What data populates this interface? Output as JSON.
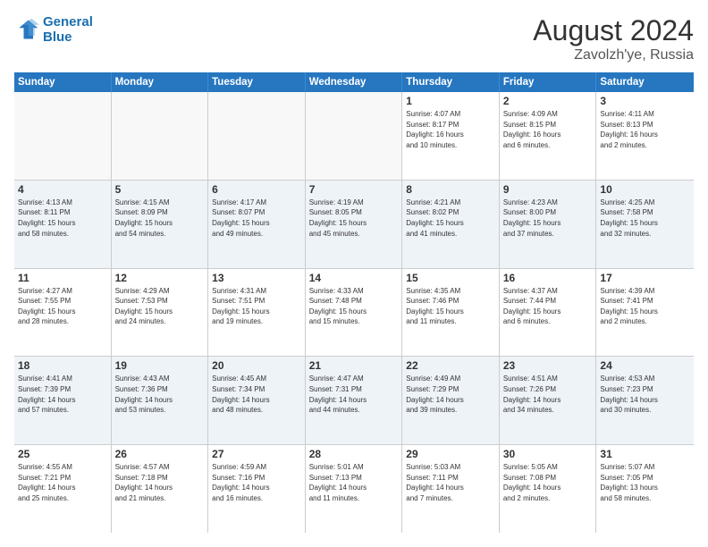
{
  "logo": {
    "line1": "General",
    "line2": "Blue"
  },
  "title": "August 2024",
  "subtitle": "Zavolzh'ye, Russia",
  "header_days": [
    "Sunday",
    "Monday",
    "Tuesday",
    "Wednesday",
    "Thursday",
    "Friday",
    "Saturday"
  ],
  "weeks": [
    [
      {
        "day": "",
        "info": ""
      },
      {
        "day": "",
        "info": ""
      },
      {
        "day": "",
        "info": ""
      },
      {
        "day": "",
        "info": ""
      },
      {
        "day": "1",
        "info": "Sunrise: 4:07 AM\nSunset: 8:17 PM\nDaylight: 16 hours\nand 10 minutes."
      },
      {
        "day": "2",
        "info": "Sunrise: 4:09 AM\nSunset: 8:15 PM\nDaylight: 16 hours\nand 6 minutes."
      },
      {
        "day": "3",
        "info": "Sunrise: 4:11 AM\nSunset: 8:13 PM\nDaylight: 16 hours\nand 2 minutes."
      }
    ],
    [
      {
        "day": "4",
        "info": "Sunrise: 4:13 AM\nSunset: 8:11 PM\nDaylight: 15 hours\nand 58 minutes."
      },
      {
        "day": "5",
        "info": "Sunrise: 4:15 AM\nSunset: 8:09 PM\nDaylight: 15 hours\nand 54 minutes."
      },
      {
        "day": "6",
        "info": "Sunrise: 4:17 AM\nSunset: 8:07 PM\nDaylight: 15 hours\nand 49 minutes."
      },
      {
        "day": "7",
        "info": "Sunrise: 4:19 AM\nSunset: 8:05 PM\nDaylight: 15 hours\nand 45 minutes."
      },
      {
        "day": "8",
        "info": "Sunrise: 4:21 AM\nSunset: 8:02 PM\nDaylight: 15 hours\nand 41 minutes."
      },
      {
        "day": "9",
        "info": "Sunrise: 4:23 AM\nSunset: 8:00 PM\nDaylight: 15 hours\nand 37 minutes."
      },
      {
        "day": "10",
        "info": "Sunrise: 4:25 AM\nSunset: 7:58 PM\nDaylight: 15 hours\nand 32 minutes."
      }
    ],
    [
      {
        "day": "11",
        "info": "Sunrise: 4:27 AM\nSunset: 7:55 PM\nDaylight: 15 hours\nand 28 minutes."
      },
      {
        "day": "12",
        "info": "Sunrise: 4:29 AM\nSunset: 7:53 PM\nDaylight: 15 hours\nand 24 minutes."
      },
      {
        "day": "13",
        "info": "Sunrise: 4:31 AM\nSunset: 7:51 PM\nDaylight: 15 hours\nand 19 minutes."
      },
      {
        "day": "14",
        "info": "Sunrise: 4:33 AM\nSunset: 7:48 PM\nDaylight: 15 hours\nand 15 minutes."
      },
      {
        "day": "15",
        "info": "Sunrise: 4:35 AM\nSunset: 7:46 PM\nDaylight: 15 hours\nand 11 minutes."
      },
      {
        "day": "16",
        "info": "Sunrise: 4:37 AM\nSunset: 7:44 PM\nDaylight: 15 hours\nand 6 minutes."
      },
      {
        "day": "17",
        "info": "Sunrise: 4:39 AM\nSunset: 7:41 PM\nDaylight: 15 hours\nand 2 minutes."
      }
    ],
    [
      {
        "day": "18",
        "info": "Sunrise: 4:41 AM\nSunset: 7:39 PM\nDaylight: 14 hours\nand 57 minutes."
      },
      {
        "day": "19",
        "info": "Sunrise: 4:43 AM\nSunset: 7:36 PM\nDaylight: 14 hours\nand 53 minutes."
      },
      {
        "day": "20",
        "info": "Sunrise: 4:45 AM\nSunset: 7:34 PM\nDaylight: 14 hours\nand 48 minutes."
      },
      {
        "day": "21",
        "info": "Sunrise: 4:47 AM\nSunset: 7:31 PM\nDaylight: 14 hours\nand 44 minutes."
      },
      {
        "day": "22",
        "info": "Sunrise: 4:49 AM\nSunset: 7:29 PM\nDaylight: 14 hours\nand 39 minutes."
      },
      {
        "day": "23",
        "info": "Sunrise: 4:51 AM\nSunset: 7:26 PM\nDaylight: 14 hours\nand 34 minutes."
      },
      {
        "day": "24",
        "info": "Sunrise: 4:53 AM\nSunset: 7:23 PM\nDaylight: 14 hours\nand 30 minutes."
      }
    ],
    [
      {
        "day": "25",
        "info": "Sunrise: 4:55 AM\nSunset: 7:21 PM\nDaylight: 14 hours\nand 25 minutes."
      },
      {
        "day": "26",
        "info": "Sunrise: 4:57 AM\nSunset: 7:18 PM\nDaylight: 14 hours\nand 21 minutes."
      },
      {
        "day": "27",
        "info": "Sunrise: 4:59 AM\nSunset: 7:16 PM\nDaylight: 14 hours\nand 16 minutes."
      },
      {
        "day": "28",
        "info": "Sunrise: 5:01 AM\nSunset: 7:13 PM\nDaylight: 14 hours\nand 11 minutes."
      },
      {
        "day": "29",
        "info": "Sunrise: 5:03 AM\nSunset: 7:11 PM\nDaylight: 14 hours\nand 7 minutes."
      },
      {
        "day": "30",
        "info": "Sunrise: 5:05 AM\nSunset: 7:08 PM\nDaylight: 14 hours\nand 2 minutes."
      },
      {
        "day": "31",
        "info": "Sunrise: 5:07 AM\nSunset: 7:05 PM\nDaylight: 13 hours\nand 58 minutes."
      }
    ]
  ]
}
